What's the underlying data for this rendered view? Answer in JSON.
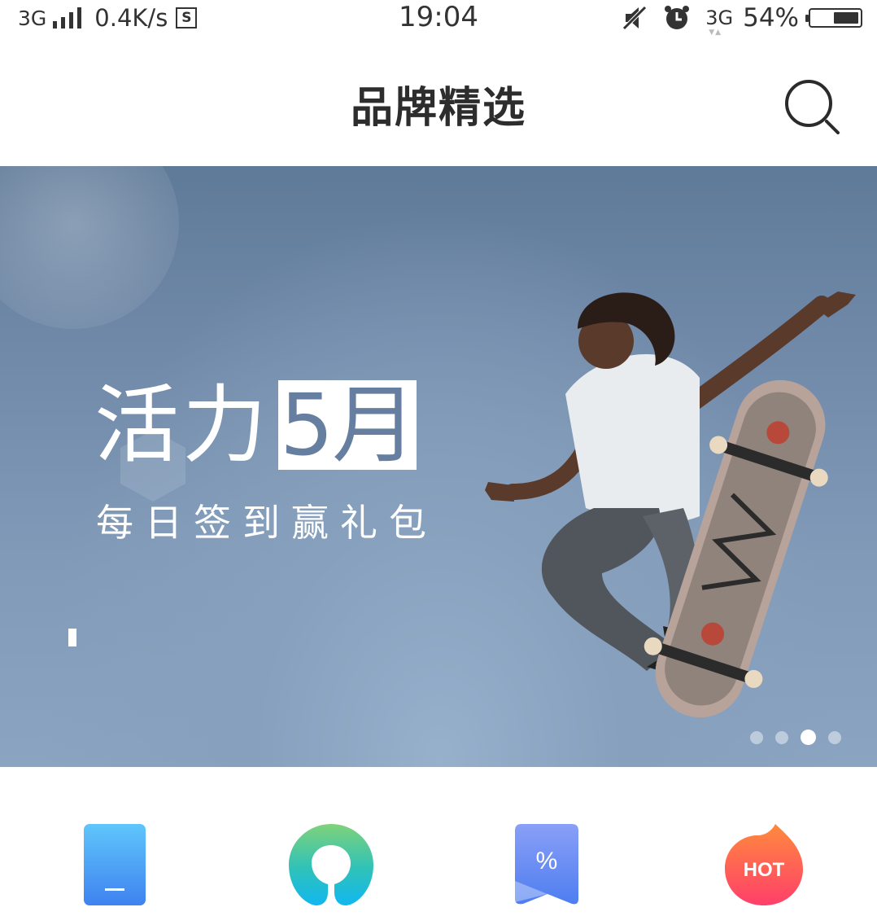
{
  "status_bar": {
    "network_left": "3G",
    "speed": "0.4K/s",
    "s_badge": "S",
    "time": "19:04",
    "network_right": "3G",
    "battery_text": "54%",
    "battery_level": 0.54,
    "icons": [
      "signal-icon",
      "mute-icon",
      "alarm-icon",
      "battery-icon"
    ]
  },
  "header": {
    "title": "品牌精选",
    "search_icon": "search-icon"
  },
  "banner": {
    "headline_a": "活力",
    "headline_b": "5月",
    "subtitle": "每日签到赢礼包",
    "active_dot": 2,
    "dot_count": 4
  },
  "quick_entries": [
    {
      "icon": "phone-icon",
      "colors": [
        "#5fc6fb",
        "#3f82f0"
      ]
    },
    {
      "icon": "leaf-logo-icon",
      "colors": [
        "#7fd27a",
        "#12b7f0"
      ]
    },
    {
      "icon": "percent-coupon-icon",
      "colors": [
        "#8a9ff7",
        "#4e7ef0"
      ],
      "label": "%"
    },
    {
      "icon": "hot-flame-icon",
      "colors": [
        "#ff8a3d",
        "#ff3f6a"
      ],
      "label": "HOT"
    }
  ]
}
